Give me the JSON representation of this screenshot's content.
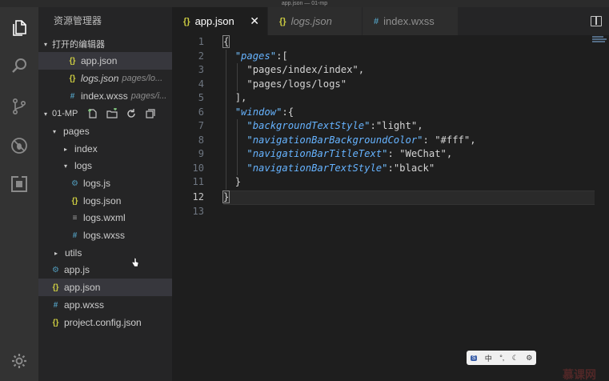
{
  "window": {
    "title": "app.json — 01-mp"
  },
  "activity": [
    "files-icon",
    "search-icon",
    "source-control-icon",
    "debug-icon",
    "extensions-icon",
    "settings-gear-icon"
  ],
  "sidebar": {
    "title": "资源管理器",
    "open_editors": {
      "label": "打开的编辑器",
      "items": [
        {
          "icon": "{}",
          "name": "app.json",
          "desc": ""
        },
        {
          "icon": "{}",
          "name": "logs.json",
          "desc": "pages/lo..."
        },
        {
          "icon": "#",
          "name": "index.wxss",
          "desc": "pages/i..."
        }
      ]
    },
    "project": {
      "label": "01-MP",
      "tree": [
        {
          "icon": "",
          "arrow": "▾",
          "name": "pages"
        },
        {
          "icon": "",
          "arrow": "▸",
          "name": "index"
        },
        {
          "icon": "",
          "arrow": "▾",
          "name": "logs"
        },
        {
          "icon": "⚙",
          "arrow": "",
          "name": "logs.js"
        },
        {
          "icon": "{}",
          "arrow": "",
          "name": "logs.json"
        },
        {
          "icon": "≡",
          "arrow": "",
          "name": "logs.wxml"
        },
        {
          "icon": "#",
          "arrow": "",
          "name": "logs.wxss"
        },
        {
          "icon": "",
          "arrow": "▸",
          "name": "utils"
        },
        {
          "icon": "⚙",
          "arrow": "",
          "name": "app.js"
        },
        {
          "icon": "{}",
          "arrow": "",
          "name": "app.json"
        },
        {
          "icon": "#",
          "arrow": "",
          "name": "app.wxss"
        },
        {
          "icon": "{}",
          "arrow": "",
          "name": "project.config.json"
        }
      ]
    }
  },
  "tabs": [
    {
      "icon": "{}",
      "label": "app.json",
      "close": "✕"
    },
    {
      "icon": "{}",
      "label": "logs.json"
    },
    {
      "icon": "#",
      "label": "index.wxss"
    }
  ],
  "editor": {
    "line_numbers": [
      "1",
      "2",
      "3",
      "4",
      "5",
      "6",
      "7",
      "8",
      "9",
      "10",
      "11",
      "12",
      "13"
    ],
    "current_line": 12
  },
  "float_toolbar": [
    "中",
    "°,",
    "☾",
    "⚙"
  ],
  "watermark": "慕课网"
}
